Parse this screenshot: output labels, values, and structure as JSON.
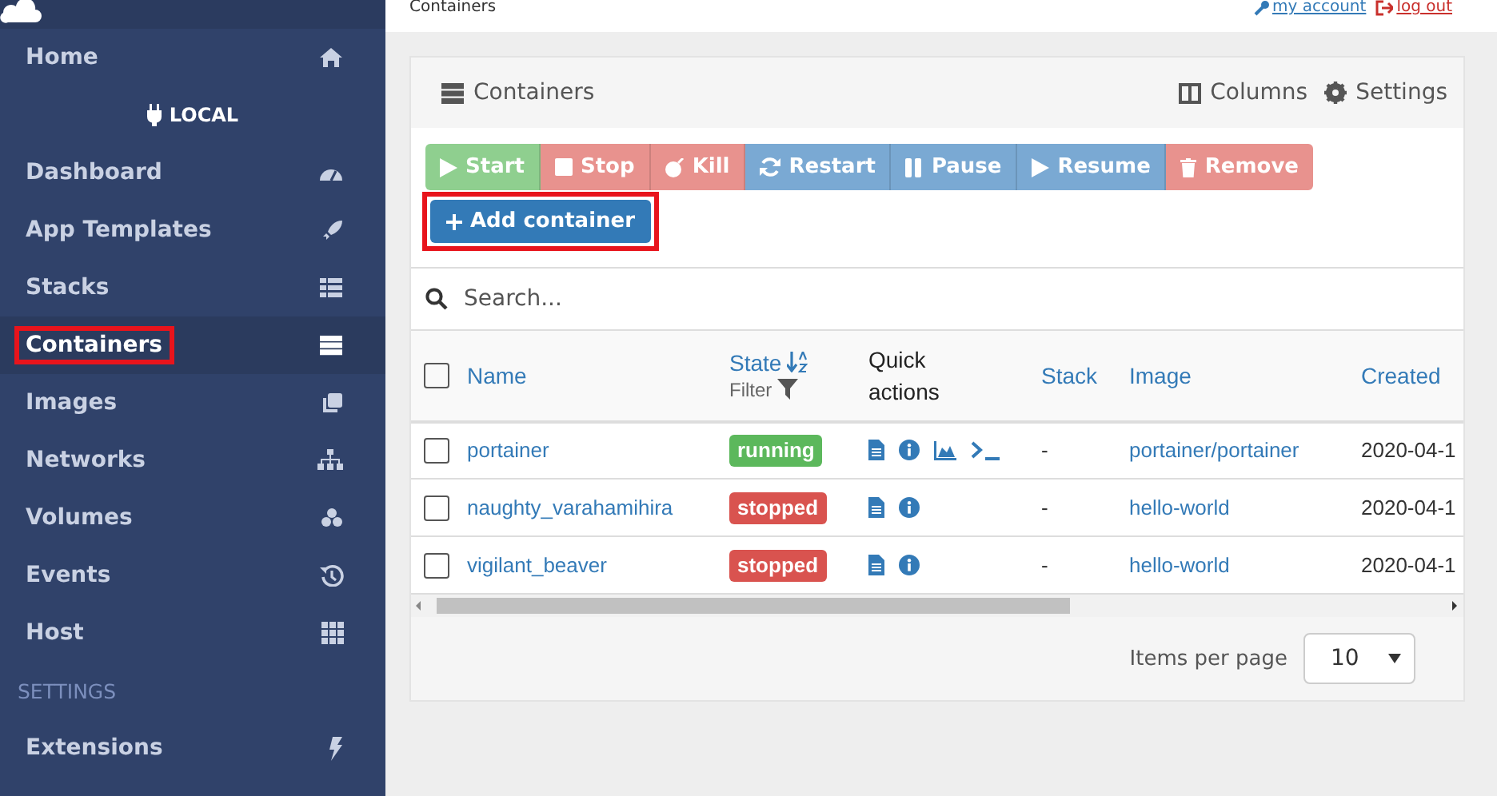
{
  "header": {
    "breadcrumb": "Containers",
    "links": [
      {
        "kind": "account",
        "label": "my account"
      },
      {
        "kind": "logout",
        "label": "log out"
      }
    ]
  },
  "sidebar": {
    "items": [
      {
        "kind": "item",
        "label": "Home",
        "selected": false,
        "highlighted": false
      },
      {
        "kind": "endpoint",
        "label": "LOCAL"
      },
      {
        "kind": "item",
        "label": "Dashboard",
        "selected": false,
        "highlighted": false
      },
      {
        "kind": "item",
        "label": "App Templates",
        "selected": false,
        "highlighted": false
      },
      {
        "kind": "item",
        "label": "Stacks",
        "selected": false,
        "highlighted": false
      },
      {
        "kind": "item",
        "label": "Containers",
        "selected": true,
        "highlighted": true
      },
      {
        "kind": "item",
        "label": "Images",
        "selected": false,
        "highlighted": false
      },
      {
        "kind": "item",
        "label": "Networks",
        "selected": false,
        "highlighted": false
      },
      {
        "kind": "item",
        "label": "Volumes",
        "selected": false,
        "highlighted": false
      },
      {
        "kind": "item",
        "label": "Events",
        "selected": false,
        "highlighted": false
      },
      {
        "kind": "item",
        "label": "Host",
        "selected": false,
        "highlighted": false
      },
      {
        "kind": "section",
        "label": "SETTINGS"
      },
      {
        "kind": "item",
        "label": "Extensions",
        "selected": false,
        "highlighted": false
      }
    ]
  },
  "panel": {
    "title": "Containers",
    "tools": [
      {
        "kind": "columns",
        "label": "Columns"
      },
      {
        "kind": "settings",
        "label": "Settings"
      }
    ],
    "actions": [
      {
        "kind": "start",
        "label": "Start"
      },
      {
        "kind": "stop",
        "label": "Stop"
      },
      {
        "kind": "kill",
        "label": "Kill"
      },
      {
        "kind": "restart",
        "label": "Restart"
      },
      {
        "kind": "pause",
        "label": "Pause"
      },
      {
        "kind": "resume",
        "label": "Resume"
      },
      {
        "kind": "remove",
        "label": "Remove"
      }
    ],
    "add_button": {
      "label": "Add container",
      "highlighted": true
    },
    "search": {
      "placeholder": "Search..."
    },
    "table": {
      "all_checked": false,
      "columns": [
        {
          "label": "Name",
          "sortable": true
        },
        {
          "label": "State",
          "sortable": true,
          "sorted": true,
          "filter": "Filter"
        },
        {
          "label": "Quick actions",
          "sortable": false
        },
        {
          "label": "Stack",
          "sortable": true
        },
        {
          "label": "Image",
          "sortable": true
        },
        {
          "label": "Created",
          "sortable": true
        }
      ],
      "rows": [
        {
          "checked": false,
          "name": "portainer",
          "state": {
            "label": "running",
            "kind": "running"
          },
          "quick_actions": [
            {
              "kind": "logs"
            },
            {
              "kind": "inspect"
            },
            {
              "kind": "stats"
            },
            {
              "kind": "console"
            }
          ],
          "stack": "-",
          "image": "portainer/portainer",
          "created": "2020-04-1"
        },
        {
          "checked": false,
          "name": "naughty_varahamihira",
          "state": {
            "label": "stopped",
            "kind": "stopped"
          },
          "quick_actions": [
            {
              "kind": "logs"
            },
            {
              "kind": "inspect"
            }
          ],
          "stack": "-",
          "image": "hello-world",
          "created": "2020-04-1"
        },
        {
          "checked": false,
          "name": "vigilant_beaver",
          "state": {
            "label": "stopped",
            "kind": "stopped"
          },
          "quick_actions": [
            {
              "kind": "logs"
            },
            {
              "kind": "inspect"
            }
          ],
          "stack": "-",
          "image": "hello-world",
          "created": "2020-04-1"
        }
      ]
    },
    "pagination": {
      "label": "Items per page",
      "value": "10"
    }
  }
}
